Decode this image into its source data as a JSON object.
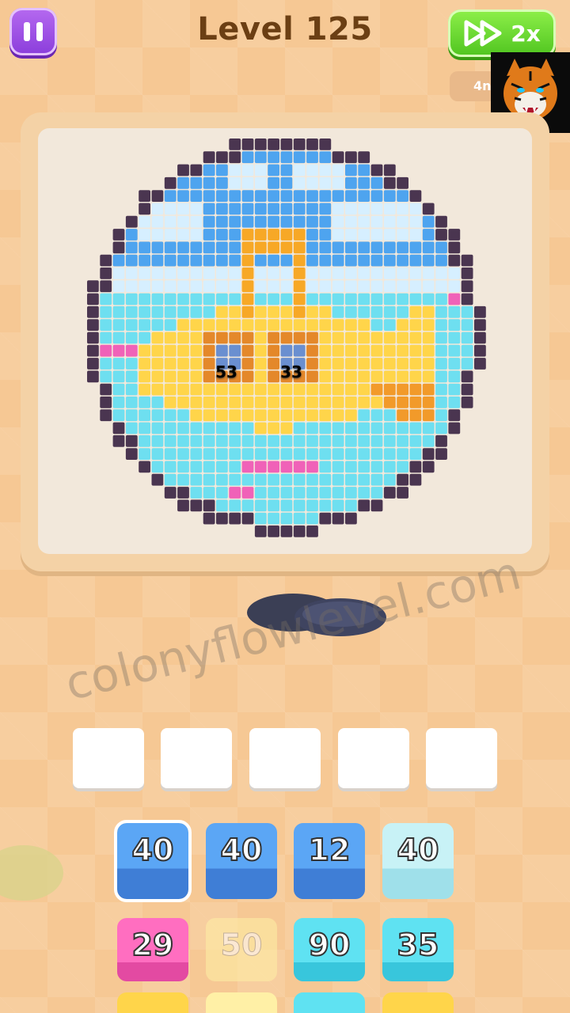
{
  "header": {
    "level_title": "Level 125",
    "speed_label": "2x",
    "moves_text": "4n"
  },
  "board": {
    "labels": [
      "53",
      "33"
    ]
  },
  "watermark": "colonyflowlevel.com",
  "slots": 5,
  "grid": [
    [
      "40",
      "40",
      "12",
      "40"
    ],
    [
      "29",
      "50",
      "90",
      "35"
    ]
  ],
  "colors": {
    "purple_button": "#9b4fe6",
    "green_button": "#5fd02a",
    "sky": "#4ea4ef",
    "cloud": "#d6efff",
    "water": "#6edff0",
    "submarine": "#ffd54a",
    "outline": "#4a3550"
  },
  "icons": [
    "pause-icon",
    "fast-forward-icon",
    "tiger-logo"
  ]
}
